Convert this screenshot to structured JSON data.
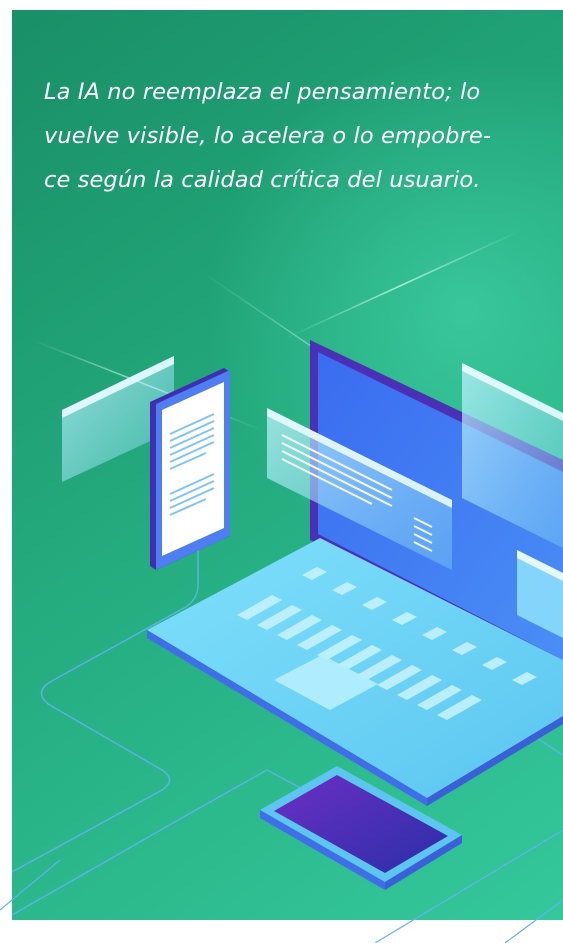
{
  "quote": {
    "lines": [
      "La IA no reemplaza el pensamiento; lo",
      "vuelve visible, lo acelera o lo empobre-",
      "ce según la calidad crítica del usuario."
    ]
  },
  "colors": {
    "card_gradient_start": "#1a8f67",
    "card_gradient_end": "#34c89b",
    "quote_text": "#ffffff",
    "laptop_base": "#6fd6f7",
    "laptop_screen": "#3f74f0",
    "laptop_bezel": "#4b2fb5",
    "accent_purple": "#5a2bb8",
    "circuit_line": "#5db4f0"
  },
  "icons": {
    "laptop": "laptop-illustration-icon",
    "phone": "smartphone-illustration-icon",
    "tablet": "tablet-illustration-icon"
  }
}
